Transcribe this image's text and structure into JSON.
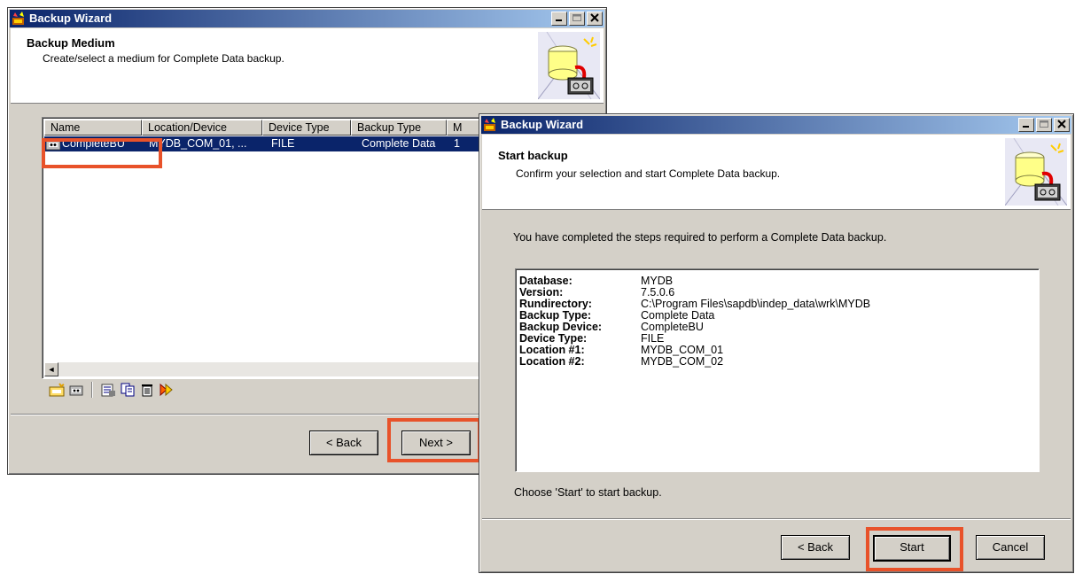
{
  "window1": {
    "title": "Backup Wizard",
    "header_title": "Backup Medium",
    "header_subtitle": "Create/select a medium for Complete Data backup.",
    "columns": [
      "Name",
      "Location/Device",
      "Device Type",
      "Backup Type",
      "M"
    ],
    "row": {
      "name": "CompleteBU",
      "location": "MYDB_COM_01, ...",
      "device_type": "FILE",
      "backup_type": "Complete Data",
      "m": "1"
    },
    "back_label": "< Back",
    "next_label": "Next >",
    "scroll_left_arrow": "◄"
  },
  "window2": {
    "title": "Backup Wizard",
    "header_title": "Start backup",
    "header_subtitle": "Confirm your selection and start Complete Data backup.",
    "intro": "You have completed the steps required to perform a Complete Data backup.",
    "summary": [
      {
        "key": "Database:",
        "value": "MYDB"
      },
      {
        "key": "Version:",
        "value": "7.5.0.6"
      },
      {
        "key": "Rundirectory:",
        "value": "C:\\Program Files\\sapdb\\indep_data\\wrk\\MYDB"
      },
      {
        "key": "Backup Type:",
        "value": "Complete Data"
      },
      {
        "key": "Backup Device:",
        "value": "CompleteBU"
      },
      {
        "key": "Device Type:",
        "value": "FILE"
      },
      {
        "key": "Location #1:",
        "value": "MYDB_COM_01"
      },
      {
        "key": "Location #2:",
        "value": "MYDB_COM_02"
      }
    ],
    "footer_text": "Choose 'Start' to start backup.",
    "back_label": "< Back",
    "start_label": "Start",
    "cancel_label": "Cancel"
  },
  "colors": {
    "highlight": "#e8522a",
    "titlebar": "#0a246a",
    "selection": "#0a246a"
  },
  "icons": [
    "wizard-app-icon",
    "database-tape-icon",
    "new-medium-icon",
    "new-tape-icon",
    "properties-icon",
    "copy-icon",
    "delete-icon",
    "run-icon"
  ]
}
